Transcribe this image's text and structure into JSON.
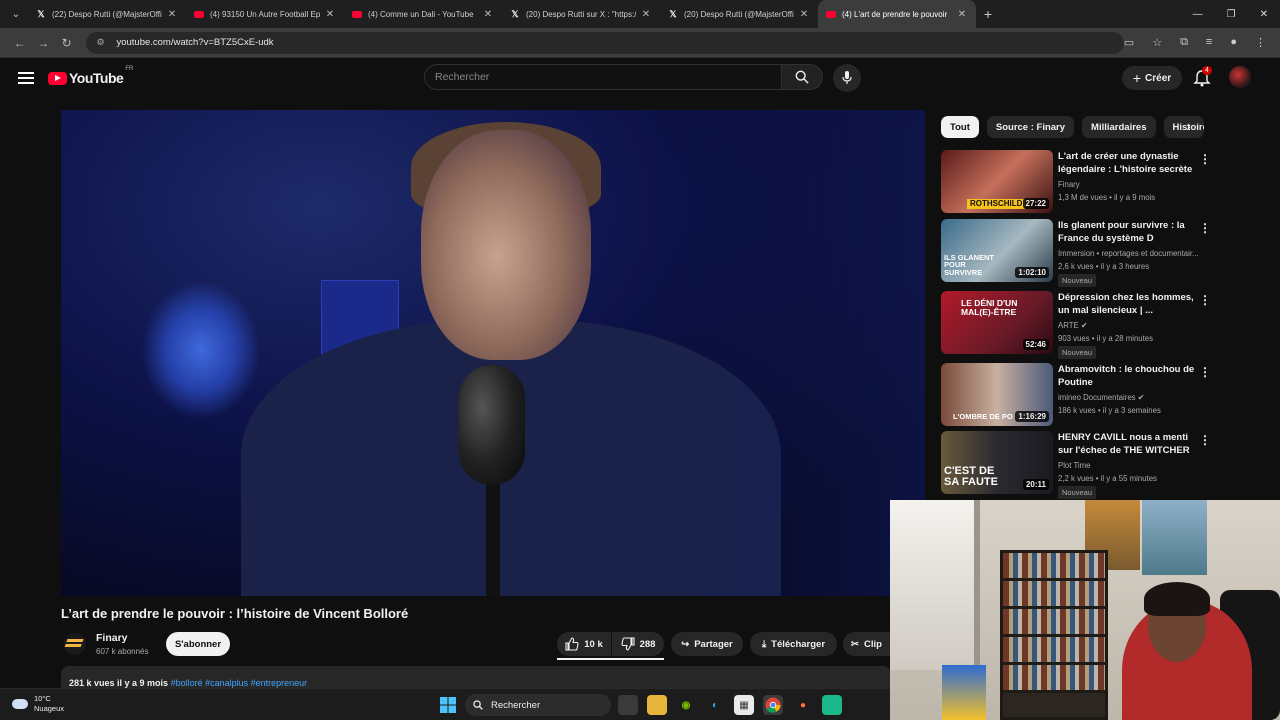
{
  "browser": {
    "tabs": [
      {
        "title": "(22) Despo Rutti (@MajsterOffic",
        "icon": "x-logo",
        "active": false
      },
      {
        "title": "(4) 93150 Un Autre Football Ep",
        "icon": "youtube-logo",
        "active": false
      },
      {
        "title": "(4) Comme un Dali - YouTube",
        "icon": "youtube-logo",
        "active": false
      },
      {
        "title": "(20) Despo Rutti sur X : \"https:/",
        "icon": "x-logo",
        "active": false
      },
      {
        "title": "(20) Despo Rutti (@MajsterOffic",
        "icon": "x-logo",
        "active": false
      },
      {
        "title": "(4) L'art de prendre le pouvoir",
        "icon": "youtube-logo",
        "active": true
      }
    ],
    "url": "youtube.com/watch?v=BTZ5CxE-udk"
  },
  "header": {
    "logo_text": "YouTube",
    "country": "FR",
    "search_placeholder": "Rechercher",
    "create_label": "Créer",
    "notification_count": "4"
  },
  "video": {
    "title": "L’art de prendre le pouvoir : l’histoire de Vincent Bolloré",
    "channel": "Finary",
    "subscribers": "607 k abonnés",
    "subscribe_label": "S'abonner",
    "likes": "10 k",
    "dislikes": "288",
    "share_label": "Partager",
    "download_label": "Télécharger",
    "clip_label": "Clip",
    "desc_stats": "281 k vues  il y a 9 mois",
    "desc_tags": "#bolloré #canalplus #entrepreneur"
  },
  "chips": [
    "Tout",
    "Source : Finary",
    "Milliardaires",
    "Histoire"
  ],
  "recommendations": [
    {
      "title": "L'art de créer une dynastie légendaire : L'histoire secrète ...",
      "channel": "Finary",
      "stats": "1,3 M de vues • il y a 9 mois",
      "duration": "27:22",
      "thumb_text": "ROTHSCHILD",
      "is_new": false
    },
    {
      "title": "Ils glanent pour survivre : la France du système D",
      "channel": "Immersion • reportages et documentair...",
      "stats": "2,6 k vues • il y a 3 heures",
      "duration": "1:02:10",
      "thumb_text": "ILS GLANENT POUR SURVIVRE",
      "is_new": true
    },
    {
      "title": "Dépression chez les hommes, un mal silencieux | ...",
      "channel": "ARTE ✔",
      "stats": "903 vues • il y a 28 minutes",
      "duration": "52:46",
      "thumb_text": "LE DÉNI D'UN MAL(E)-ÊTRE",
      "is_new": true
    },
    {
      "title": "Abramovitch : le chouchou de Poutine",
      "channel": "imineo Documentaires ✔",
      "stats": "186 k vues • il y a 3 semaines",
      "duration": "1:16:29",
      "thumb_text": "L'OMBRE DE PO",
      "is_new": false
    },
    {
      "title": "HENRY CAVILL nous a menti sur l'échec de THE WITCHER d...",
      "channel": "Plot Time",
      "stats": "2,2 k vues • il y a 55 minutes",
      "duration": "20:11",
      "thumb_text": "C'EST DE SA FAUTE",
      "is_new": true
    }
  ],
  "new_label": "Nouveau",
  "taskbar": {
    "temperature": "10°C",
    "weather": "Nuageux",
    "search_label": "Rechercher"
  },
  "colors": {
    "brand": "#ff0033",
    "background": "#0f0f0f",
    "link": "#3ea6ff"
  }
}
